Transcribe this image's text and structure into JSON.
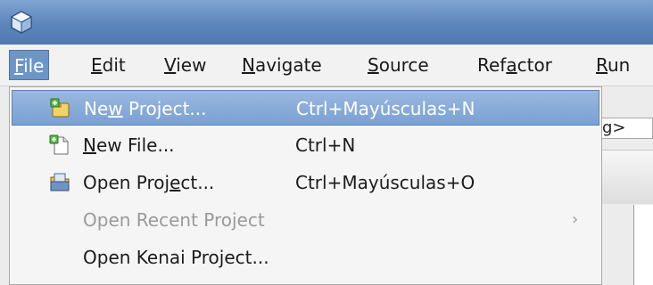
{
  "app": {
    "icon": "cube-icon"
  },
  "menubar": {
    "items": [
      {
        "pre": "",
        "mn": "F",
        "post": "ile"
      },
      {
        "pre": "",
        "mn": "E",
        "post": "dit"
      },
      {
        "pre": "",
        "mn": "V",
        "post": "iew"
      },
      {
        "pre": "",
        "mn": "N",
        "post": "avigate"
      },
      {
        "pre": "",
        "mn": "S",
        "post": "ource"
      },
      {
        "pre": "Ref",
        "mn": "a",
        "post": "ctor"
      },
      {
        "pre": "",
        "mn": "R",
        "post": "un"
      }
    ]
  },
  "background": {
    "combo_text": "g>"
  },
  "file_menu": {
    "items": [
      {
        "pre": "Ne",
        "mn": "w",
        "post": " Project...",
        "shortcut": "Ctrl+Mayúsculas+N",
        "icon": "new-project-icon",
        "state": "highlighted"
      },
      {
        "pre": "",
        "mn": "N",
        "post": "ew File...",
        "shortcut": "Ctrl+N",
        "icon": "new-file-icon",
        "state": "normal"
      },
      {
        "pre": "Open Proj",
        "mn": "e",
        "post": "ct...",
        "shortcut": "Ctrl+Mayúsculas+O",
        "icon": "open-project-icon",
        "state": "normal"
      },
      {
        "pre": "Open Recent Pro",
        "mn": "j",
        "post": "ect",
        "shortcut": "",
        "submenu_arrow": "›",
        "state": "disabled"
      },
      {
        "pre": "Open Kenai Project...",
        "mn": "",
        "post": "",
        "shortcut": "",
        "state": "normal"
      }
    ]
  },
  "colors": {
    "titlebar": "#5d86bd",
    "highlight": "#7aa0d2",
    "active_menu": "#6d95c8"
  }
}
